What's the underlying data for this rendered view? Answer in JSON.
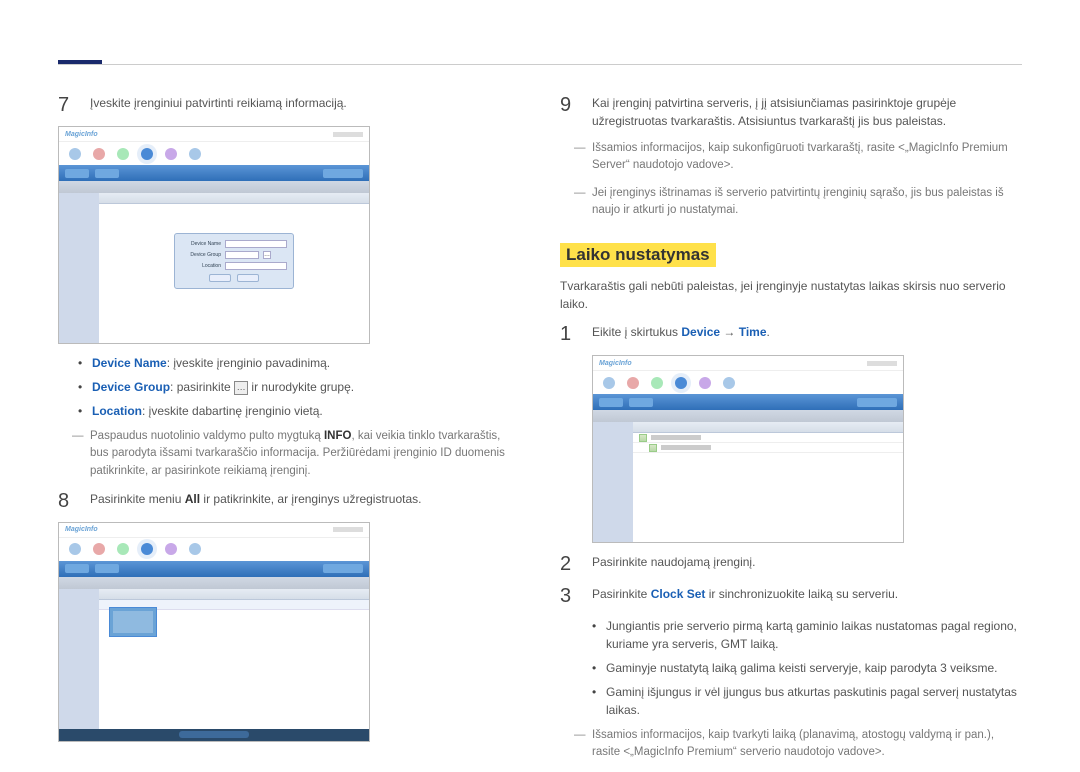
{
  "left": {
    "step7": {
      "num": "7",
      "text": "Įveskite įrenginiui patvirtinti reikiamą informaciją."
    },
    "bullets": [
      {
        "kw": "Device Name",
        "rest": ": įveskite įrenginio pavadinimą."
      },
      {
        "kw": "Device Group",
        "rest1": ": pasirinkite ",
        "rest2": " ir nurodykite grupę."
      },
      {
        "kw": "Location",
        "rest": ": įveskite dabartinę įrenginio vietą."
      }
    ],
    "note7": {
      "pre": "Paspaudus nuotolinio valdymo pulto mygtuką ",
      "bold": "INFO",
      "post": ", kai veikia tinklo tvarkaraštis, bus parodyta išsami tvarkaraščio informacija. Peržiūrėdami įrenginio ID duomenis patikrinkite, ar pasirinkote reikiamą įrenginį."
    },
    "step8": {
      "num": "8",
      "pre": "Pasirinkite meniu ",
      "bold": "All",
      "post": " ir patikrinkite, ar įrenginys užregistruotas."
    },
    "shot_logo": "MagicInfo"
  },
  "right": {
    "step9": {
      "num": "9",
      "text": "Kai įrenginį patvirtina serveris, į jį atsisiunčiamas pasirinktoje grupėje užregistruotas tvarkaraštis. Atsisiuntus tvarkaraštį jis bus paleistas."
    },
    "note9a": "Išsamios informacijos, kaip sukonfigūruoti tvarkaraštį, rasite <„MagicInfo Premium Server“ naudotojo vadove>.",
    "note9b": "Jei įrenginys ištrinamas iš serverio patvirtintų įrenginių sąrašo, jis bus paleistas iš naujo ir atkurti jo nustatymai.",
    "heading": "Laiko nustatymas",
    "intro": "Tvarkaraštis gali nebūti paleistas, jei įrenginyje nustatytas laikas skirsis nuo serverio laiko.",
    "step1": {
      "num": "1",
      "pre": "Eikite į skirtukus ",
      "kw1": "Device",
      "arrow": " → ",
      "kw2": "Time",
      "post": "."
    },
    "step2": {
      "num": "2",
      "text": "Pasirinkite naudojamą įrenginį."
    },
    "step3": {
      "num": "3",
      "pre": "Pasirinkite ",
      "kw": "Clock Set",
      "post": " ir sinchronizuokite laiką su serveriu."
    },
    "bullets": [
      "Jungiantis prie serverio pirmą kartą gaminio laikas nustatomas pagal regiono, kuriame yra serveris, GMT laiką.",
      "Gaminyje nustatytą laiką galima keisti serveryje, kaip parodyta 3 veiksme.",
      "Gaminį išjungus ir vėl įjungus bus atkurtas paskutinis pagal serverį nustatytas laikas."
    ],
    "note_end": "Išsamios informacijos, kaip tvarkyti laiką (planavimą, atostogų valdymą ir pan.), rasite <„MagicInfo Premium“ serverio naudotojo vadove>."
  }
}
